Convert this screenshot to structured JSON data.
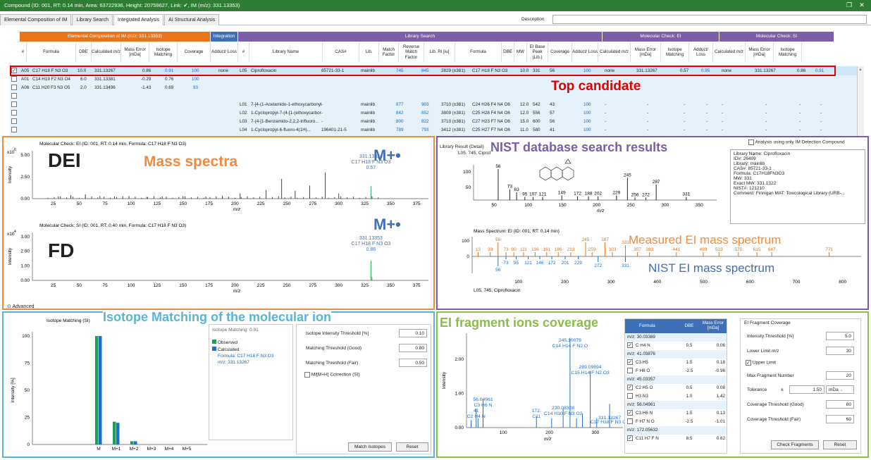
{
  "titlebar": {
    "text": "Compound (ID: 001, RT: 0.14 min, Area: 63722936, Height: 20759627, Link: ✔, IM (m/z): 331.13353)"
  },
  "tabs": [
    "Elemental Composition of IM",
    "Library Search",
    "Integrated Analysis",
    "AI Structural Analysis"
  ],
  "description_label": "Description",
  "groups": {
    "ec": "Elemental Composition of IM (m/z: 331.13353)",
    "integration": "Integration",
    "lib": "Library Search",
    "ei": "Molecular Check: EI",
    "si": "Molecular Check: SI"
  },
  "cols": {
    "ec": [
      "#",
      "Formula",
      "DBE",
      "Calculated m/z",
      "Mass Error [mDa]",
      "Isotope Matching",
      "Coverage"
    ],
    "integration": [
      "Adduct/ Loss"
    ],
    "lib": [
      "#",
      "Library Name",
      "CAS#",
      "Lib.",
      "Match Factor",
      "Reverse Match Factor",
      "Lib. RI [iu]",
      "Formula",
      "DBE",
      "MW",
      "EI Base Peak (Lib.)",
      "Coverage"
    ],
    "ei": [
      "Adduct/ Loss",
      "Calculated m/z",
      "Mass Error [mDa]",
      "Isotope Matching"
    ],
    "si": [
      "Adduct/ Loss",
      "Calculated m/z",
      "Mass Error [mDa]",
      "Isotope Matching"
    ]
  },
  "ec_rows": [
    {
      "id": "A05",
      "formula": "C17 H18 F N3 O3",
      "dbe": "10.0",
      "mz": "331.13267",
      "err": "0.86",
      "iso": "0.91",
      "cov": "100",
      "checked": "✓"
    },
    {
      "id": "A01",
      "formula": "C14 H19 F2 N3 O4",
      "dbe": "6.0",
      "mz": "331.13381",
      "err": "-0.29",
      "iso": "0.76",
      "cov": "100",
      "checked": ""
    },
    {
      "id": "A06",
      "formula": "C11 H20 F3 N3 O5",
      "dbe": "2.0",
      "mz": "331.13496",
      "err": "-1.43",
      "iso": "0.69",
      "cov": "93",
      "checked": ""
    }
  ],
  "int_row": "none",
  "lib_rows": [
    {
      "id": "L05",
      "name": "Ciprofloxacin",
      "cas": "85721-33-1",
      "lib": "mainlib",
      "mf": "745",
      "rmf": "845",
      "ri": "2829 (±381)",
      "formula": "C17 H18 F N3 O3",
      "dbe": "10.0",
      "mw": "331",
      "bp": "56",
      "cov": "100"
    },
    {
      "id": "L01",
      "name": "7-[4-(1-Acetamido-1-ethoxycarbonyl...",
      "cas": "-",
      "lib": "mainlib",
      "mf": "877",
      "rmf": "903",
      "ri": "3710 (±381)",
      "formula": "C24 H26 F4 N4 O6",
      "dbe": "12.0",
      "mw": "542",
      "bp": "43",
      "cov": "100"
    },
    {
      "id": "L02",
      "name": "1-Cyclopropyl-7-(4-[1-(ethoxycarbonyl...",
      "cas": "-",
      "lib": "mainlib",
      "mf": "842",
      "rmf": "852",
      "ri": "3809 (±381)",
      "formula": "C25 H28 F4 N4 O6",
      "dbe": "12.0",
      "mw": "556",
      "bp": "57",
      "cov": "100"
    },
    {
      "id": "L03",
      "name": "7-(4-[1-Benzamido-2,2,2-trifluoro...",
      "cas": "-",
      "lib": "mainlib",
      "mf": "800",
      "rmf": "822",
      "ri": "3713 (±381)",
      "formula": "C27 H23 F7 N4 O6",
      "dbe": "15.0",
      "mw": "600",
      "bp": "56",
      "cov": "100"
    },
    {
      "id": "L04",
      "name": "1-Cyclopropyl-6-fluoro-4(1H)...",
      "cas": "196401-21-5",
      "lib": "mainlib",
      "mf": "789",
      "rmf": "793",
      "ri": "3412 (±381)",
      "formula": "C25 H27 F7 N4 O6",
      "dbe": "11.0",
      "mw": "580",
      "bp": "41",
      "cov": "100"
    }
  ],
  "ei_row": {
    "adduct": "none",
    "mz": "331.13267",
    "err": "0.57",
    "iso": "0.95"
  },
  "si_row": {
    "adduct": "none",
    "mz": "331.13267",
    "err": "0.86",
    "iso": "0.91"
  },
  "dash": "-",
  "annotations": {
    "top_candidate": "Top candidate",
    "dei": "DEI",
    "mass_spectra": "Mass spectra",
    "fd": "FD",
    "mplus": "M+•",
    "nist": "NIST database search results",
    "measured": "Measured EI mass spectrum",
    "nist_ei": "NIST EI mass spectrum",
    "isotope": "Isotope Matching of the molecular ion",
    "fragment": "EI fragment ions coverage"
  },
  "ei_chart": {
    "title": "Molecular Check: EI (ID: 001, RT: 0.14 min, Formula: C17 H18 F N3 O3)",
    "exp": "x10",
    "exp_power": "6",
    "ylabel": "Intensity",
    "xlabel": "m/z",
    "yticks": [
      "5.00",
      "2.50",
      "0.00"
    ],
    "xticks": [
      "25",
      "50",
      "75",
      "100",
      "125",
      "150",
      "175",
      "200",
      "225",
      "250",
      "275",
      "300",
      "325",
      "350",
      "375"
    ],
    "annot": [
      "331.13324",
      "C17 H18 F N3 O3",
      "0.57"
    ]
  },
  "si_chart": {
    "title": "Molecular Check: SI (ID: 001, RT: 0.40 min, Formula: C17 H18 F N3 O3)",
    "exp": "x10",
    "exp_power": "4",
    "ylabel": "Intensity",
    "xlabel": "m/z",
    "yticks": [
      "3.00",
      "2.00",
      "1.00",
      "0.00"
    ],
    "xticks": [
      "25",
      "50",
      "75",
      "100",
      "125",
      "150",
      "175",
      "200",
      "225",
      "250",
      "275",
      "300",
      "325",
      "350",
      "375"
    ],
    "annot": [
      "331.13353",
      "C17 H18 F N3 O3",
      "0.86"
    ]
  },
  "advanced": "Advanced",
  "lib_result": {
    "title": "Library Result (Detail)",
    "sub": "L05, 745, Ciprofloxacin",
    "checkbox": "Analysis using only IM Detection Compound",
    "info": [
      "Library Name: Ciprofloxacin",
      "ID#: 26409",
      "Library: mainlib",
      "CAS#: 85721-33-1",
      "Formula: C17H18FN3O3",
      "MW: 331",
      "Exact MW: 331.1322",
      "NIST#: 121210",
      "Comment: Finnigan MAT: Toxicological Library (URB-..."
    ],
    "peaks": [
      "56",
      "73",
      "83",
      "95",
      "107",
      "121",
      "149",
      "172",
      "188",
      "202",
      "229",
      "245",
      "256",
      "272",
      "287",
      "331"
    ],
    "yticks": [
      "100",
      "50"
    ],
    "xticks": [
      "50",
      "100",
      "150",
      "200",
      "250",
      "300",
      "350"
    ],
    "xlabel": "m/z"
  },
  "mirror": {
    "title": "Mass Spectrum: EI (ID: 001, RT: 0.14 min)",
    "yticks": [
      "100",
      "0"
    ],
    "xticks": [
      "100",
      "200",
      "300",
      "400",
      "500",
      "600",
      "700",
      "800"
    ],
    "top_labels": [
      "13",
      "39",
      "56",
      "73",
      "90",
      "111",
      "136",
      "161",
      "186",
      "213",
      "245",
      "259",
      "287",
      "303",
      "331",
      "357",
      "383",
      "441",
      "499",
      "533",
      "575",
      "615",
      "647",
      "771"
    ],
    "bot_labels": [
      "56",
      "73",
      "95",
      "121",
      "146",
      "172",
      "201",
      "229",
      "272",
      "331"
    ],
    "footer": "L05, 745, Ciprofloxacin"
  },
  "iso_chart": {
    "title": "Isotope Matching (SI)",
    "ylabel": "Intensity [%]",
    "yticks": [
      "100",
      "75",
      "50",
      "25",
      "0"
    ],
    "cats": [
      "M",
      "M+1",
      "M+2",
      "M+3",
      "M+4",
      "M+5"
    ],
    "series": [
      {
        "name": "Observed",
        "values": [
          100,
          21,
          3,
          0,
          0,
          0
        ]
      },
      {
        "name": "Calculated",
        "values": [
          100,
          20,
          3,
          0,
          0,
          0
        ]
      }
    ]
  },
  "iso_legend": {
    "heading": "Isotope Matching: 0.91",
    "observed": "Observed",
    "calculated": "Calculated",
    "formula": "Formula: C17 H18 F N3 O3",
    "mz": "m/z: 331.13267"
  },
  "iso_settings": {
    "rows": [
      {
        "label": "Isotope Intensity Threshold [%]",
        "value": "0.10"
      },
      {
        "label": "Matching Threshold (Good)",
        "value": "0.80"
      },
      {
        "label": "Matching Threshold (Fair)",
        "value": "0.50"
      }
    ],
    "correction": "M/[M+H] Correction (SI)",
    "match_btn": "Match Isotopes",
    "reset_btn": "Reset"
  },
  "frag_chart": {
    "ylabel": "Intensity",
    "xlabel": "m/z",
    "yticks": [
      "2.00",
      "1.00",
      "0.00"
    ],
    "xticks": [
      "100",
      "200",
      "300"
    ],
    "labels": [
      "245.10078",
      "C14 H14 F N2 O",
      "289.09894",
      "C15 H14 F N2 O3",
      "56.04961",
      "C3 H6 N",
      "41",
      "C2 H4 N",
      "172.",
      "C11",
      "230.08328",
      "C14 H10 F N3 O2",
      "331.13267",
      "C17 H18 F N3 O3"
    ]
  },
  "frag_table": {
    "headers": [
      "Formula",
      "DBE",
      "Mass Error [mDa]"
    ],
    "rows": [
      {
        "type": "mz",
        "text": "m/z: 30.03389"
      },
      {
        "type": "f",
        "chk": "✓",
        "formula": "C H4 N",
        "dbe": "0.5",
        "err": "0.06"
      },
      {
        "type": "mz",
        "text": "m/z: 41.03876"
      },
      {
        "type": "f",
        "chk": "✓",
        "formula": "C3 H5",
        "dbe": "1.5",
        "err": "0.18"
      },
      {
        "type": "f",
        "chk": "",
        "formula": "F H6 O",
        "dbe": "-2.5",
        "err": "-0.96"
      },
      {
        "type": "mz",
        "text": "m/z: 45.03357"
      },
      {
        "type": "f",
        "chk": "✓",
        "formula": "C2 H5 O",
        "dbe": "0.5",
        "err": "0.08"
      },
      {
        "type": "f",
        "chk": "",
        "formula": "H3 N3",
        "dbe": "1.0",
        "err": "1.42"
      },
      {
        "type": "mz",
        "text": "m/z: 56.04961"
      },
      {
        "type": "f",
        "chk": "✓",
        "formula": "C3 H6 N",
        "dbe": "1.5",
        "err": "0.13"
      },
      {
        "type": "f",
        "chk": "",
        "formula": "F H7 N O",
        "dbe": "-2.5",
        "err": "-1.01"
      },
      {
        "type": "mz",
        "text": "m/z: 172.05632"
      },
      {
        "type": "f",
        "chk": "✓",
        "formula": "C11 H7 F N",
        "dbe": "8.5",
        "err": "0.62"
      }
    ]
  },
  "frag_settings": {
    "heading": "EI Fragment Coverage",
    "rows": [
      {
        "label": "Intensity Threshold [%]",
        "value": "5.0"
      },
      {
        "label": "Lower Limit m/z",
        "value": "30"
      },
      {
        "label": "Upper Limit",
        "value": ""
      },
      {
        "label": "Max Fragment Number",
        "value": "20"
      },
      {
        "label": "Tolerance",
        "value": "1.50"
      },
      {
        "label": "Coverage Threshold (Good)",
        "value": "80"
      },
      {
        "label": "Coverage Threshold (Fair)",
        "value": "60"
      }
    ],
    "tol_pm": "±",
    "tol_unit": "mDa",
    "check_btn": "Check Fragments",
    "reset_btn": "Reset"
  },
  "colors": {
    "green": "#2e7d32",
    "orange": "#e8741c",
    "blue_header": "#3f6fb5",
    "purple": "#7b5ea7",
    "red": "#e00000",
    "orange_ann": "#f08a3c",
    "purple_ann": "#7b5ea7",
    "teal_ann": "#5bb3d6",
    "lime_ann": "#8bbd4a"
  }
}
